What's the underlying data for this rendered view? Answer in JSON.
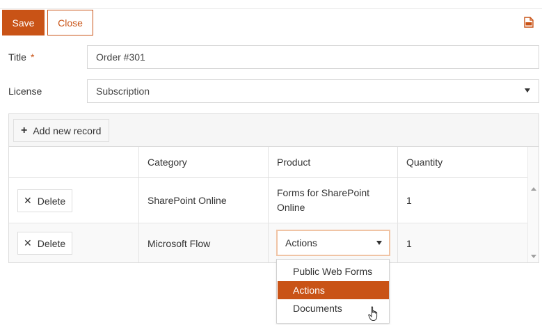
{
  "toolbar": {
    "save_label": "Save",
    "close_label": "Close",
    "pdf_icon": "pdf-icon"
  },
  "form": {
    "title_label": "Title",
    "required_mark": "*",
    "title_value": "Order #301",
    "license_label": "License",
    "license_value": "Subscription"
  },
  "grid": {
    "add_label": "Add new record",
    "columns": [
      "",
      "Category",
      "Product",
      "Quantity"
    ],
    "rows": [
      {
        "delete_label": "Delete",
        "category": "SharePoint Online",
        "product": "Forms for SharePoint Online",
        "quantity": "1"
      },
      {
        "delete_label": "Delete",
        "category": "Microsoft Flow",
        "product": "Actions",
        "quantity": "1"
      }
    ]
  },
  "product_dropdown": {
    "selected": "Actions",
    "options": [
      "Public Web Forms",
      "Actions",
      "Documents"
    ]
  },
  "colors": {
    "accent": "#c95316",
    "focus_border": "#f0c4a5"
  }
}
